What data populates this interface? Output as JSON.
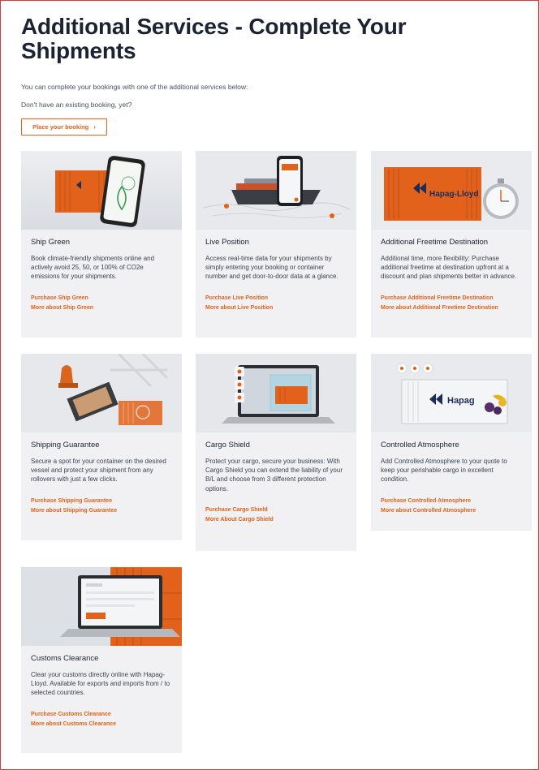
{
  "page": {
    "title": "Additional Services - Complete Your Shipments",
    "intro": "You can complete your bookings with one of the additional services below:",
    "prompt": "Don't have an existing booking, yet?",
    "cta_label": "Place your booking",
    "cta_icon": "chevron-right-icon"
  },
  "colors": {
    "accent": "#e2621b",
    "card_bg": "#f1f1f3",
    "heading": "#1b2332",
    "frame": "#d63b3b"
  },
  "cards": [
    {
      "title": "Ship Green",
      "description": "Book climate-friendly shipments online and actively avoid 25, 50, or 100% of CO2e emissions for your shipments.",
      "links": [
        "Purchase Ship Green",
        "More about Ship Green"
      ],
      "image": "container-phone-leaf"
    },
    {
      "title": "Live Position",
      "description": "Access real-time data for your shipments by simply entering your booking or container number and get door-to-door data at a glance.",
      "links": [
        "Purchase Live Position",
        "More about Live Position"
      ],
      "image": "ship-phone-map"
    },
    {
      "title": "Additional Freetime Destination",
      "description": "Additional time, more flexibility: Purchase additional freetime at destination upfront at a discount and plan shipments better in advance.",
      "links": [
        "Purchase Additional Freetime Destination",
        "More about Additional Freetime Destination"
      ],
      "image": "container-stopwatch",
      "logo_text": "Hapag-Lloyd"
    },
    {
      "title": "Shipping Guarantee",
      "description": "Secure a spot for your container on the desired vessel and protect your shipment from any rollovers with just a few clicks.",
      "links": [
        "Purchase Shipping Guarantee",
        "More about Shipping Guarantee"
      ],
      "image": "stamp-crane"
    },
    {
      "title": "Cargo Shield",
      "description": "Protect your cargo, secure your business: With Cargo Shield you can extend the liability of your B/L and choose from 3 different protection options.",
      "links": [
        "Purchase Cargo Shield",
        "More About Cargo Shield"
      ],
      "image": "laptop-shield-container"
    },
    {
      "title": "Controlled Atmosphere",
      "description": "Add Controlled Atmosphere to your quote to keep your perishable cargo in excellent condition.",
      "links": [
        "Purchase Controlled Atmosphere",
        "More about Controlled Atmosphere"
      ],
      "image": "reefer-container-fruit",
      "logo_text": "Hapag"
    },
    {
      "title": "Customs Clearance",
      "description": "Clear your customs directly online with Hapag-Lloyd. Available for exports and imports from / to selected countries.",
      "links": [
        "Purchase Customs Clearance",
        "More about Customs Clearance"
      ],
      "image": "laptop-containers"
    }
  ]
}
